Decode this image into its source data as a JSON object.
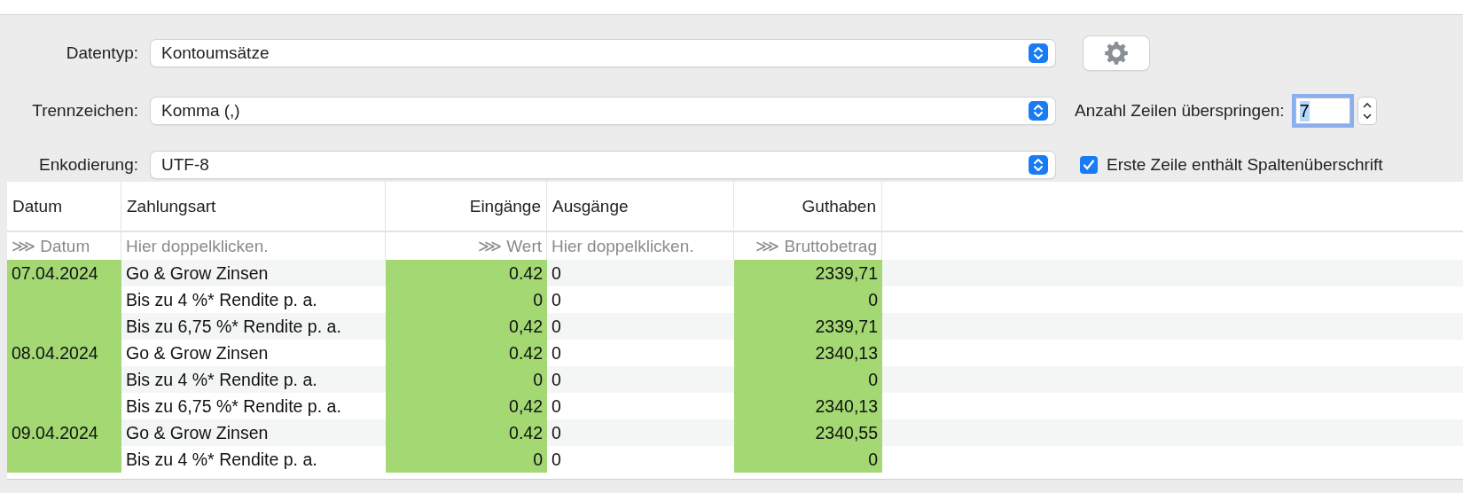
{
  "settings": {
    "rows": [
      {
        "label": "Datentyp:",
        "value": "Kontoumsätze"
      },
      {
        "label": "Trennzeichen:",
        "value": "Komma (,)"
      },
      {
        "label": "Enkodierung:",
        "value": "UTF-8"
      }
    ],
    "settings_button": {
      "kind": "gear"
    },
    "skip_rows": {
      "label": "Anzahl Zeilen überspringen:",
      "value": "7",
      "focused": true
    },
    "header_checkbox": {
      "label": "Erste Zeile enthält Spaltenüberschrift",
      "checked": true
    }
  },
  "table": {
    "columns": [
      {
        "label": "Datum",
        "mapping": "⋙ Datum",
        "kind": "text",
        "highlighted": true
      },
      {
        "label": "Zahlungsart",
        "mapping": "Hier doppelklicken.",
        "kind": "text",
        "highlighted": false
      },
      {
        "label": "Eingänge",
        "mapping": "⋙ Wert",
        "kind": "number",
        "highlighted": true
      },
      {
        "label": "Ausgänge",
        "mapping": "Hier doppelklicken.",
        "kind": "text",
        "highlighted": false
      },
      {
        "label": "Guthaben",
        "mapping": "⋙ Bruttobetrag",
        "kind": "number",
        "highlighted": true
      }
    ],
    "rows": [
      [
        "07.04.2024",
        "Go & Grow Zinsen",
        "0.42",
        "0",
        "2339,71"
      ],
      [
        "",
        "Bis zu 4 %* Rendite p. a.",
        "0",
        "0",
        "0"
      ],
      [
        "",
        "Bis zu 6,75 %* Rendite p. a.",
        "0,42",
        "0",
        "2339,71"
      ],
      [
        "08.04.2024",
        "Go & Grow Zinsen",
        "0.42",
        "0",
        "2340,13"
      ],
      [
        "",
        "Bis zu 4 %* Rendite p. a.",
        "0",
        "0",
        "0"
      ],
      [
        "",
        "Bis zu 6,75 %* Rendite p. a.",
        "0,42",
        "0",
        "2340,13"
      ],
      [
        "09.04.2024",
        "Go & Grow Zinsen",
        "0.42",
        "0",
        "2340,55"
      ],
      [
        "",
        "Bis zu 4 %* Rendite p. a.",
        "0",
        "0",
        "0"
      ]
    ]
  }
}
